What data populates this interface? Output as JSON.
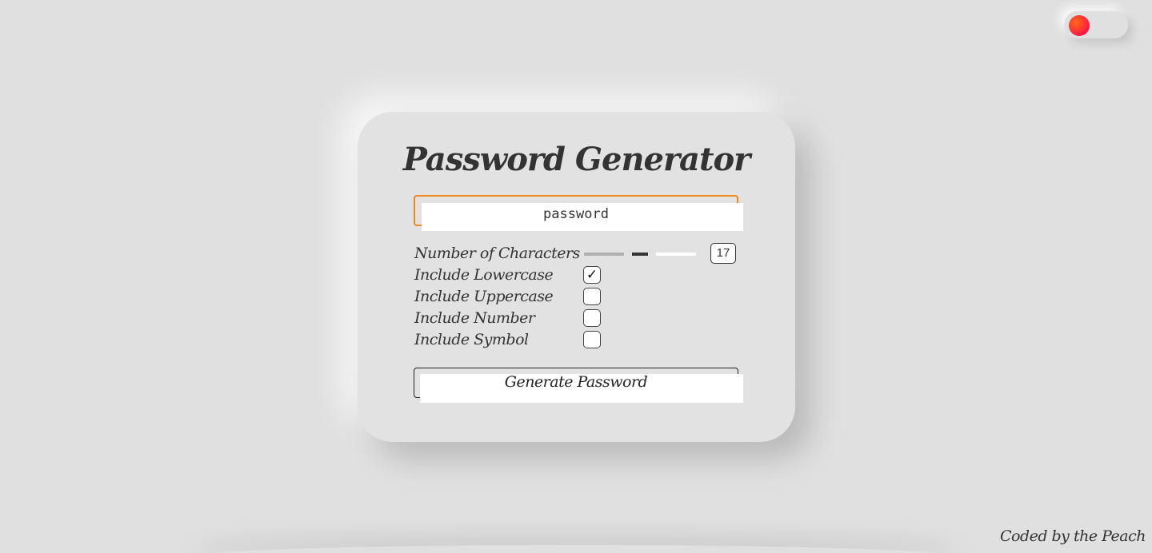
{
  "theme_toggle": {
    "knob_color": "#ff3b2a"
  },
  "card": {
    "title": "Password Generator",
    "password_value": "password",
    "options": {
      "length_label": "Number of Characters",
      "length_value": "17",
      "lowercase_label": "Include Lowercase",
      "lowercase_checked": "✓",
      "uppercase_label": "Include Uppercase",
      "number_label": "Include Number",
      "symbol_label": "Include Symbol"
    },
    "generate_label": "Generate Password"
  },
  "footer": {
    "credit": "Coded by the Peach"
  },
  "colors": {
    "background": "#e0e0e0",
    "accent_border": "#f08a1c"
  }
}
